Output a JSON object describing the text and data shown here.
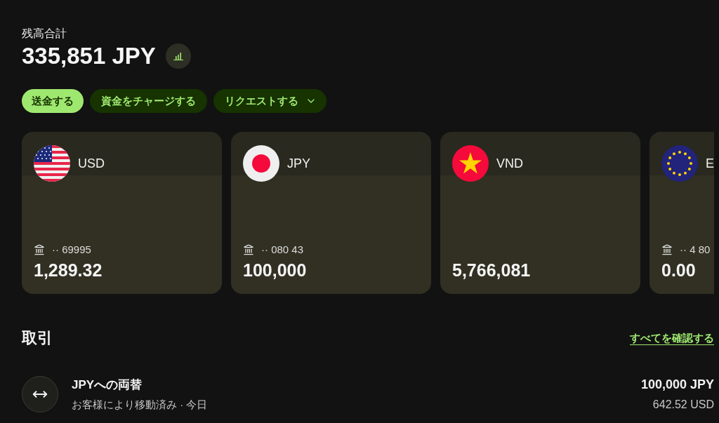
{
  "balance": {
    "label": "残高合計",
    "amount": "335,851 JPY"
  },
  "actions": [
    {
      "label": "送金する",
      "kind": "primary"
    },
    {
      "label": "資金をチャージする",
      "kind": "secondary"
    },
    {
      "label": "リクエストする",
      "kind": "dropdown"
    }
  ],
  "accounts": [
    {
      "kind": "us",
      "currency": "USD",
      "account": "·· 69995",
      "balance": "1,289.32"
    },
    {
      "kind": "jp",
      "currency": "JPY",
      "account": "·· 080 43",
      "balance": "100,000"
    },
    {
      "kind": "vn",
      "currency": "VND",
      "balance": "5,766,081"
    },
    {
      "kind": "eu",
      "currency": "E",
      "account": "·· 4 80",
      "balance": "0.00"
    }
  ],
  "transactions": {
    "title": "取引",
    "link": "すべてを確認する",
    "items": [
      {
        "kind": "exchange",
        "title": "JPYへの両替",
        "subtitle": "お客様により移動済み · 今日",
        "amount": "100,000 JPY",
        "secondary_amount": "642.52 USD"
      }
    ]
  }
}
